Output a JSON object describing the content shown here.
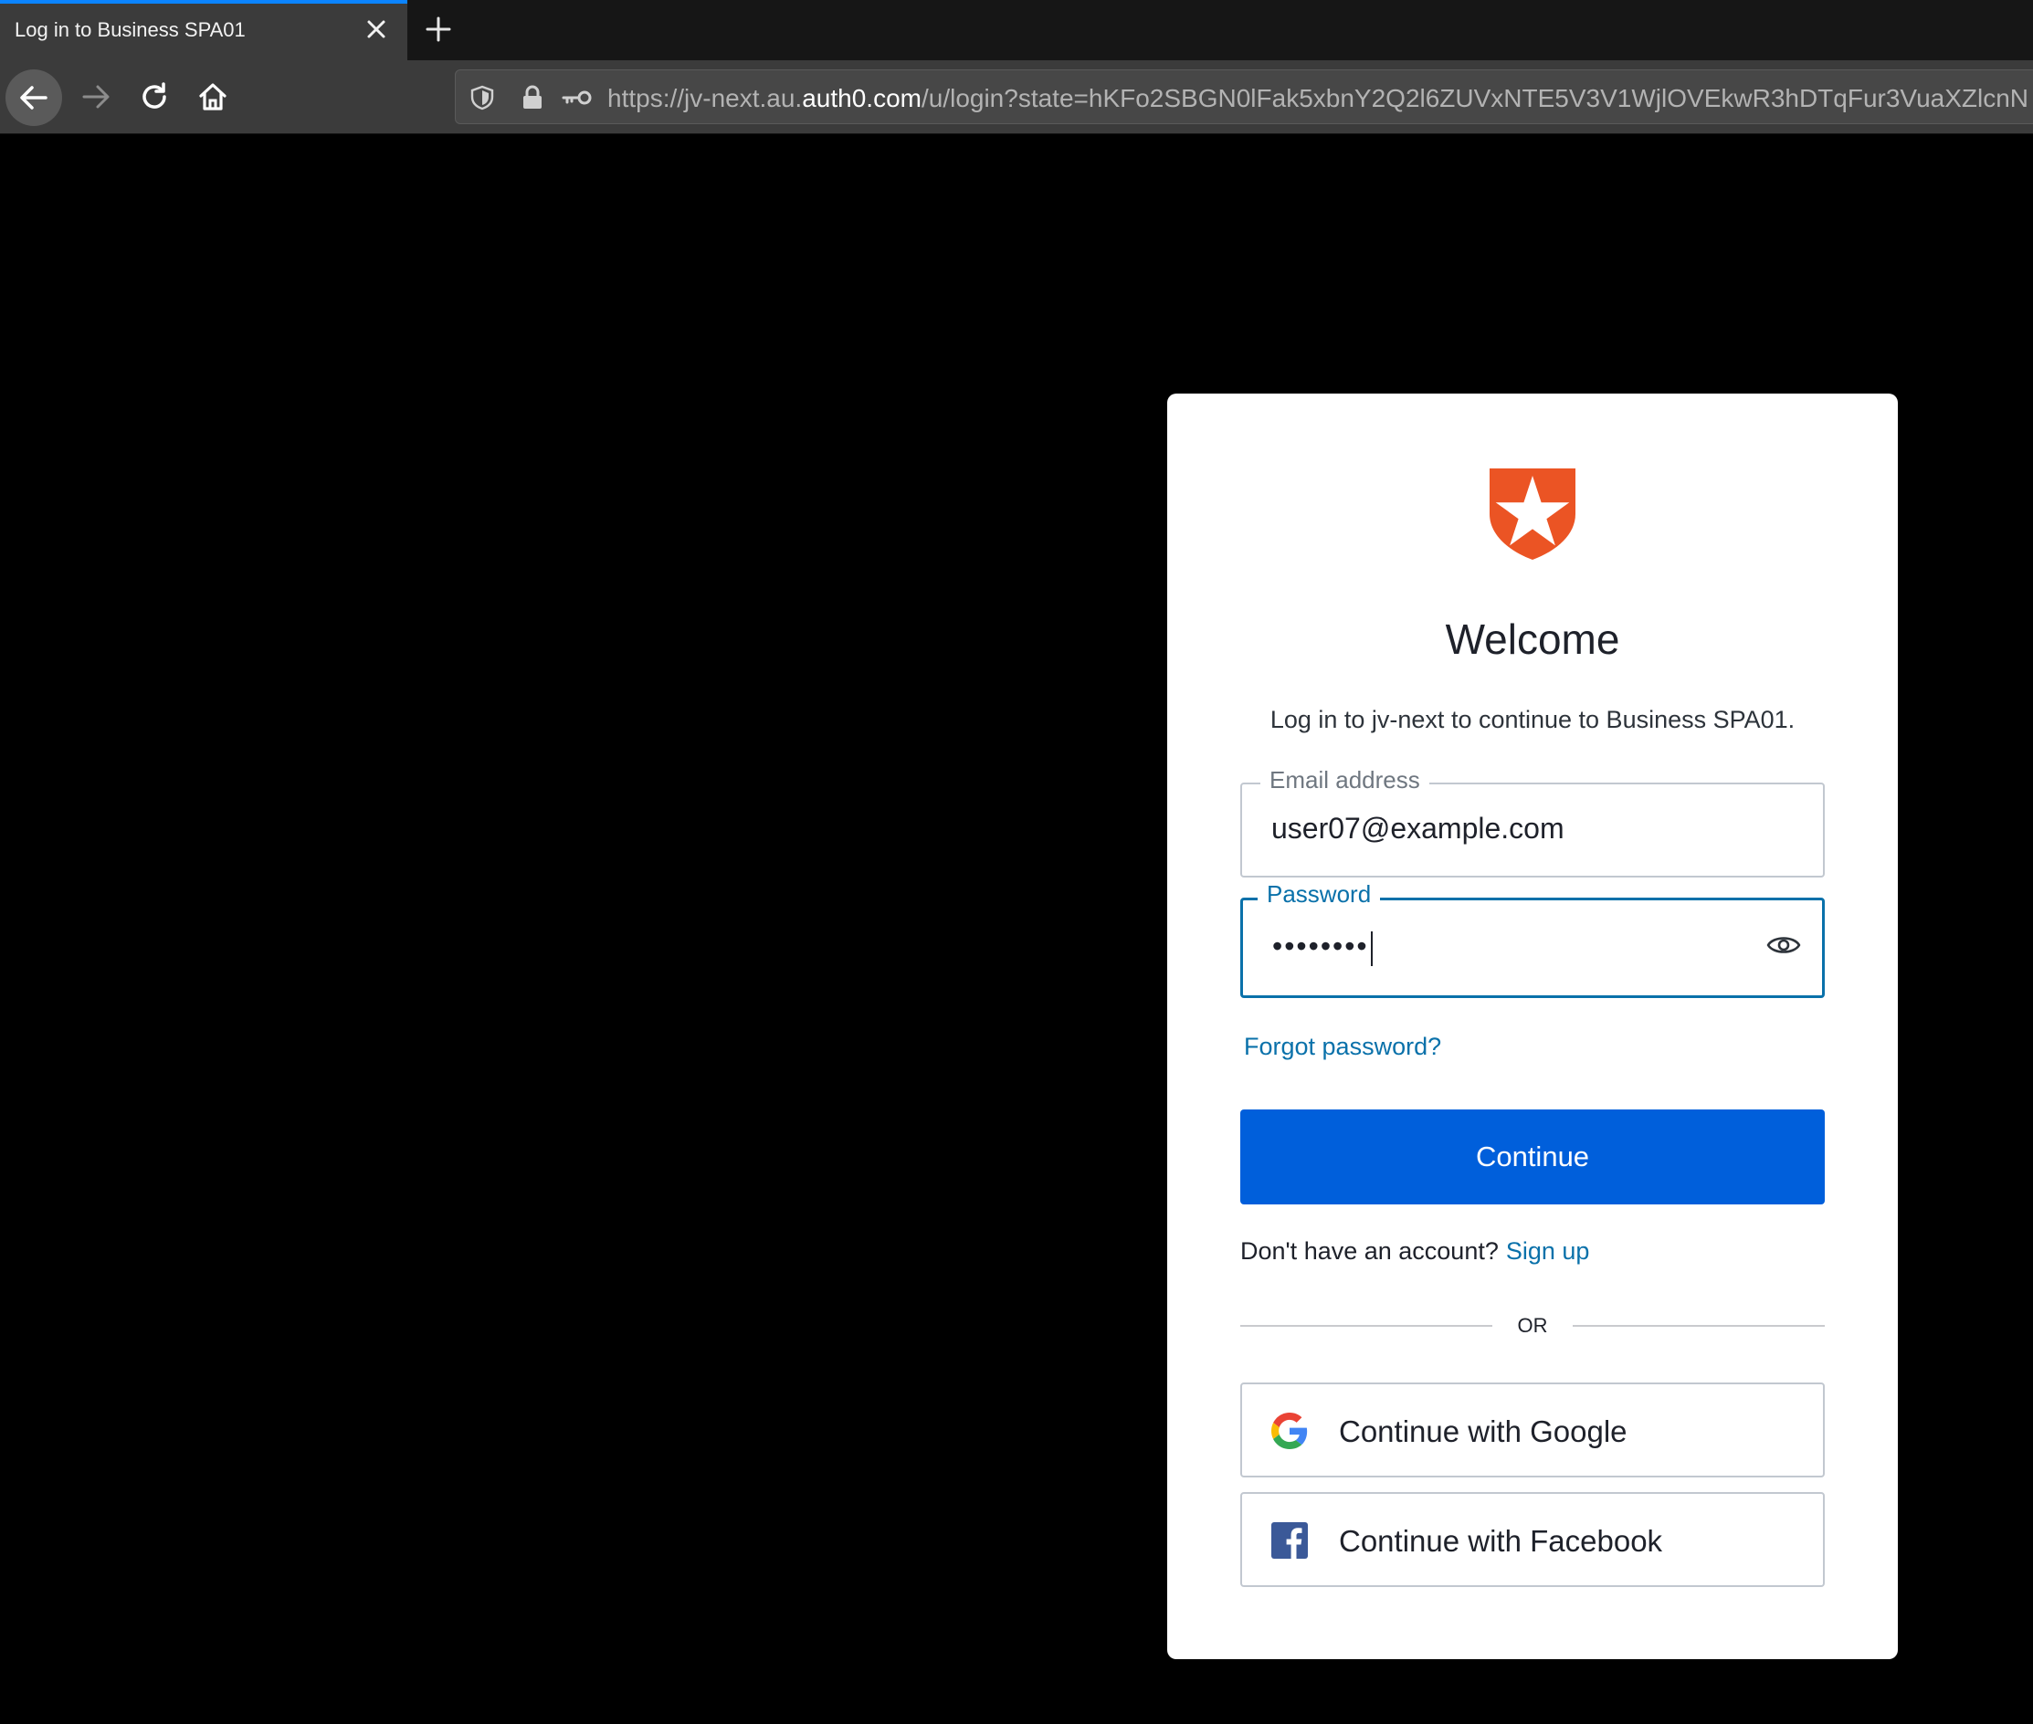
{
  "browser": {
    "tab_title": "Log in to Business SPA01",
    "url_prefix": "https://jv-next.au.",
    "url_host": "auth0.com",
    "url_path": "/u/login?state=hKFo2SBGN0lFak5xbnY2Q2l6ZUVxNTE5V3V1WjlOVEkwR3hDTqFur3VuaXZlcnN"
  },
  "login": {
    "heading": "Welcome",
    "subtitle": "Log in to jv-next to continue to Business SPA01.",
    "email_label": "Email address",
    "email_value": "user07@example.com",
    "password_label": "Password",
    "password_masked": "••••••••",
    "forgot_password": "Forgot password?",
    "continue_label": "Continue",
    "no_account_text": "Don't have an account?",
    "signup_label": "Sign up",
    "or_text": "OR",
    "google_label": "Continue with Google",
    "facebook_label": "Continue with Facebook"
  },
  "colors": {
    "brand_orange": "#eb5424",
    "primary_button": "#005fdb",
    "link": "#0a71aa",
    "tab_accent": "#0b84ff"
  }
}
